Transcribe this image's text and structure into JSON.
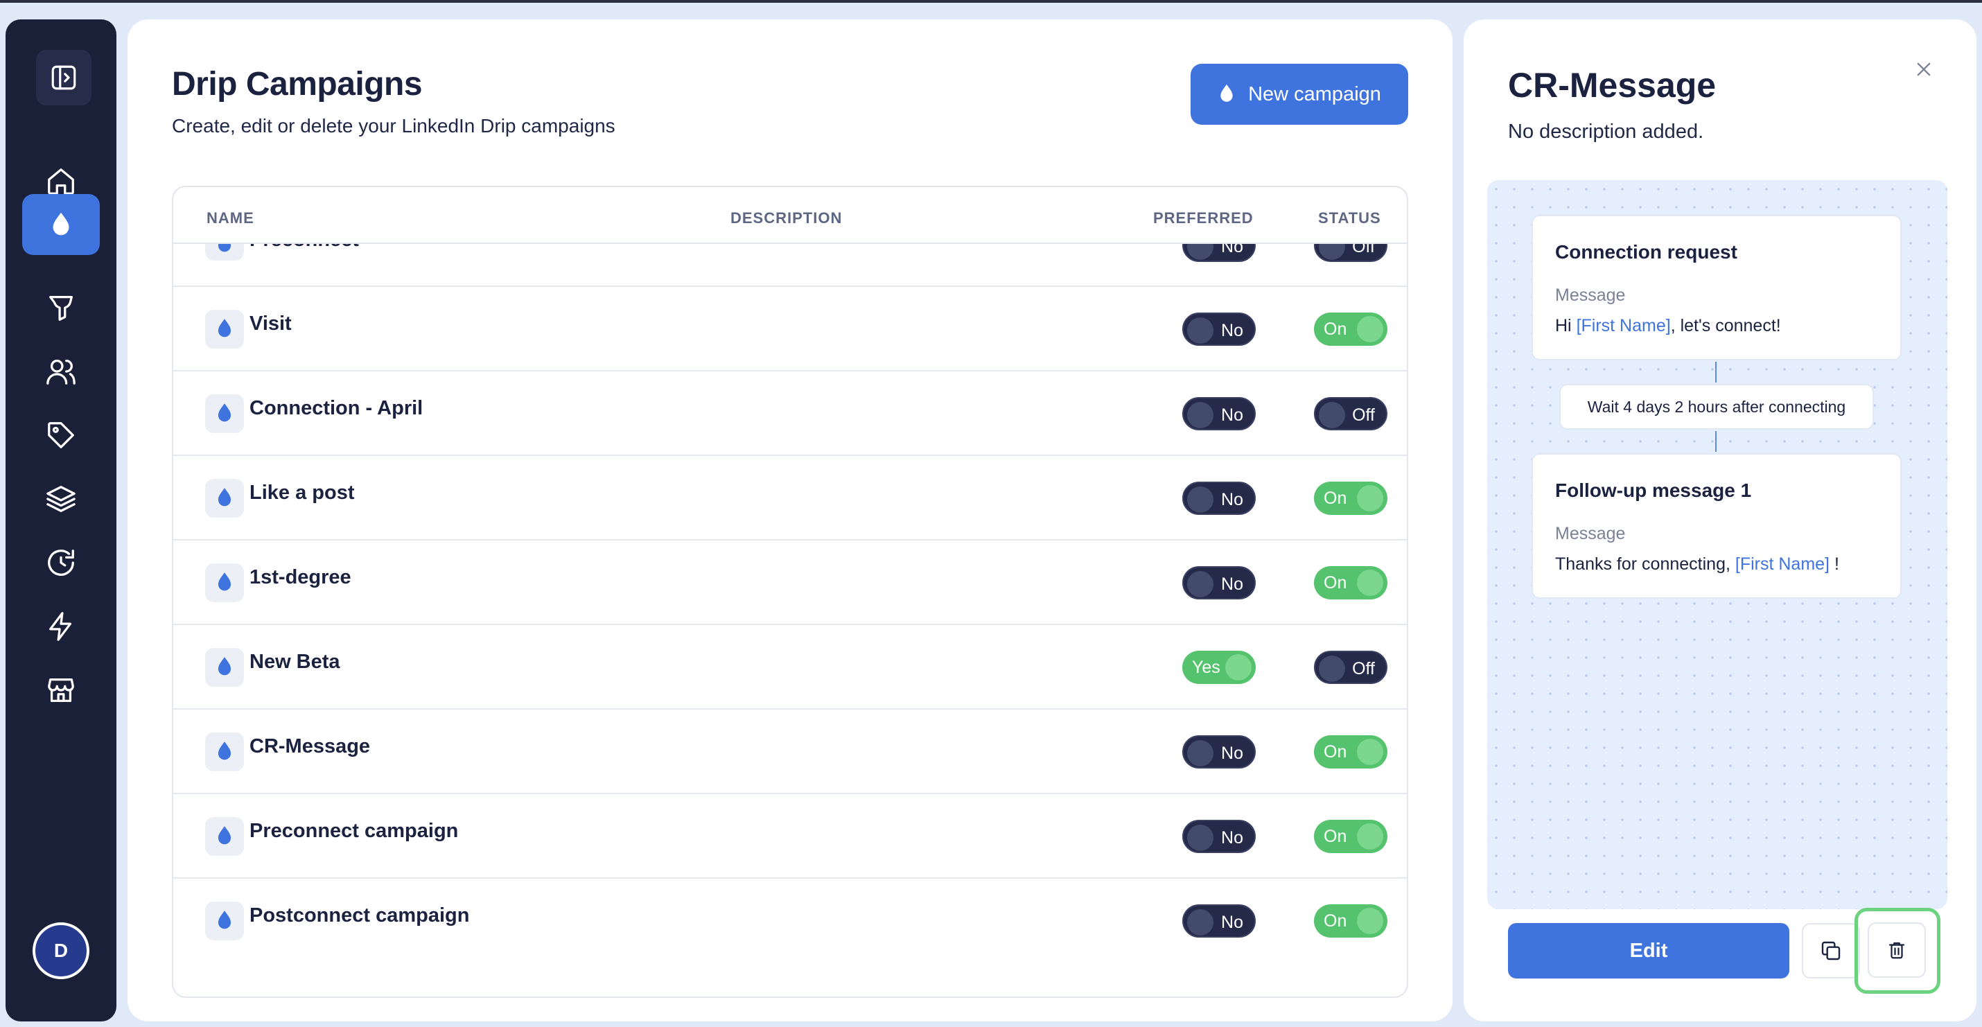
{
  "sidebar": {
    "toggle_icon": "sidebar-toggle-icon",
    "items": [
      {
        "icon": "home-icon",
        "active": false
      },
      {
        "icon": "drip-icon",
        "active": true
      },
      {
        "icon": "funnel-icon",
        "active": false
      },
      {
        "icon": "users-icon",
        "active": false
      },
      {
        "icon": "tag-icon",
        "active": false
      },
      {
        "icon": "layers-icon",
        "active": false
      },
      {
        "icon": "refresh-icon",
        "active": false
      },
      {
        "icon": "lightning-icon",
        "active": false
      },
      {
        "icon": "store-icon",
        "active": false
      }
    ],
    "avatar_initial": "D"
  },
  "main": {
    "title": "Drip Campaigns",
    "subtitle": "Create, edit or delete your LinkedIn Drip campaigns",
    "new_campaign_label": "New campaign",
    "columns": {
      "name": "NAME",
      "description": "DESCRIPTION",
      "preferred": "PREFERRED",
      "status": "STATUS"
    },
    "rows": [
      {
        "name": "Preconnect",
        "preferred": "No",
        "status": "Off"
      },
      {
        "name": "Visit",
        "preferred": "No",
        "status": "On"
      },
      {
        "name": "Connection - April",
        "preferred": "No",
        "status": "Off"
      },
      {
        "name": "Like a post",
        "preferred": "No",
        "status": "On"
      },
      {
        "name": "1st-degree",
        "preferred": "No",
        "status": "On"
      },
      {
        "name": "New Beta",
        "preferred": "Yes",
        "status": "Off"
      },
      {
        "name": "CR-Message",
        "preferred": "No",
        "status": "On"
      },
      {
        "name": "Preconnect campaign",
        "preferred": "No",
        "status": "On"
      },
      {
        "name": "Postconnect campaign",
        "preferred": "No",
        "status": "On"
      }
    ]
  },
  "detail": {
    "title": "CR-Message",
    "description": "No description added.",
    "step1": {
      "title": "Connection request",
      "label": "Message",
      "text_before": "Hi ",
      "variable": "[First Name]",
      "text_after": ", let's connect!"
    },
    "wait": "Wait 4 days 2 hours after connecting",
    "step2": {
      "title": "Follow-up message 1",
      "label": "Message",
      "text_before": "Thanks for connecting, ",
      "variable": "[First Name]",
      "text_after": " !"
    },
    "edit_label": "Edit"
  },
  "colors": {
    "accent": "#3f73dd",
    "sidebar_bg": "#1b2039",
    "toggle_on": "#55c36e",
    "toggle_off": "#242a48",
    "highlight": "#6bd27f"
  }
}
